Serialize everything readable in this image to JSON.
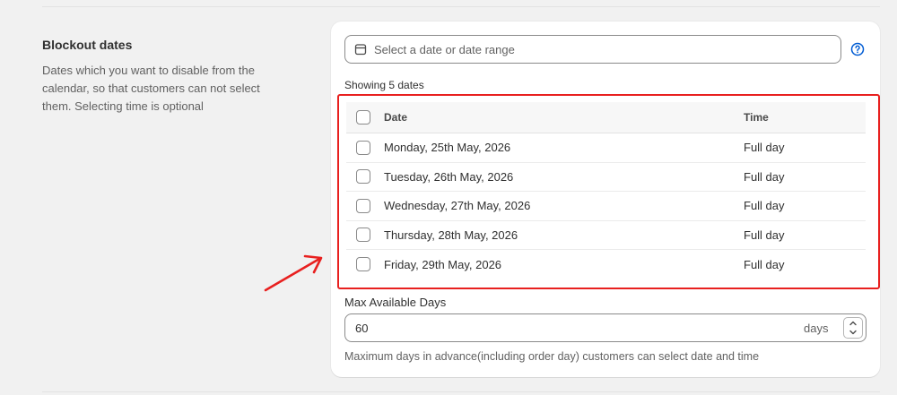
{
  "section": {
    "title": "Blockout dates",
    "description": "Dates which you want to disable from the calendar, so that customers can not select them. Selecting time is optional"
  },
  "date_picker": {
    "placeholder": "Select a date or date range",
    "icon": "calendar-icon",
    "help_icon": "question-circle-icon"
  },
  "showing_text": "Showing 5 dates",
  "table": {
    "headers": {
      "date": "Date",
      "time": "Time"
    },
    "rows": [
      {
        "date": "Monday, 25th May, 2026",
        "time": "Full day"
      },
      {
        "date": "Tuesday, 26th May, 2026",
        "time": "Full day"
      },
      {
        "date": "Wednesday, 27th May, 2026",
        "time": "Full day"
      },
      {
        "date": "Thursday, 28th May, 2026",
        "time": "Full day"
      },
      {
        "date": "Friday, 29th May, 2026",
        "time": "Full day"
      }
    ]
  },
  "max_days": {
    "label": "Max Available Days",
    "value": "60",
    "suffix": "days",
    "help": "Maximum days in advance(including order day) customers can select date and time"
  },
  "colors": {
    "annotation": "#e8201f",
    "accent": "#005bd3"
  }
}
